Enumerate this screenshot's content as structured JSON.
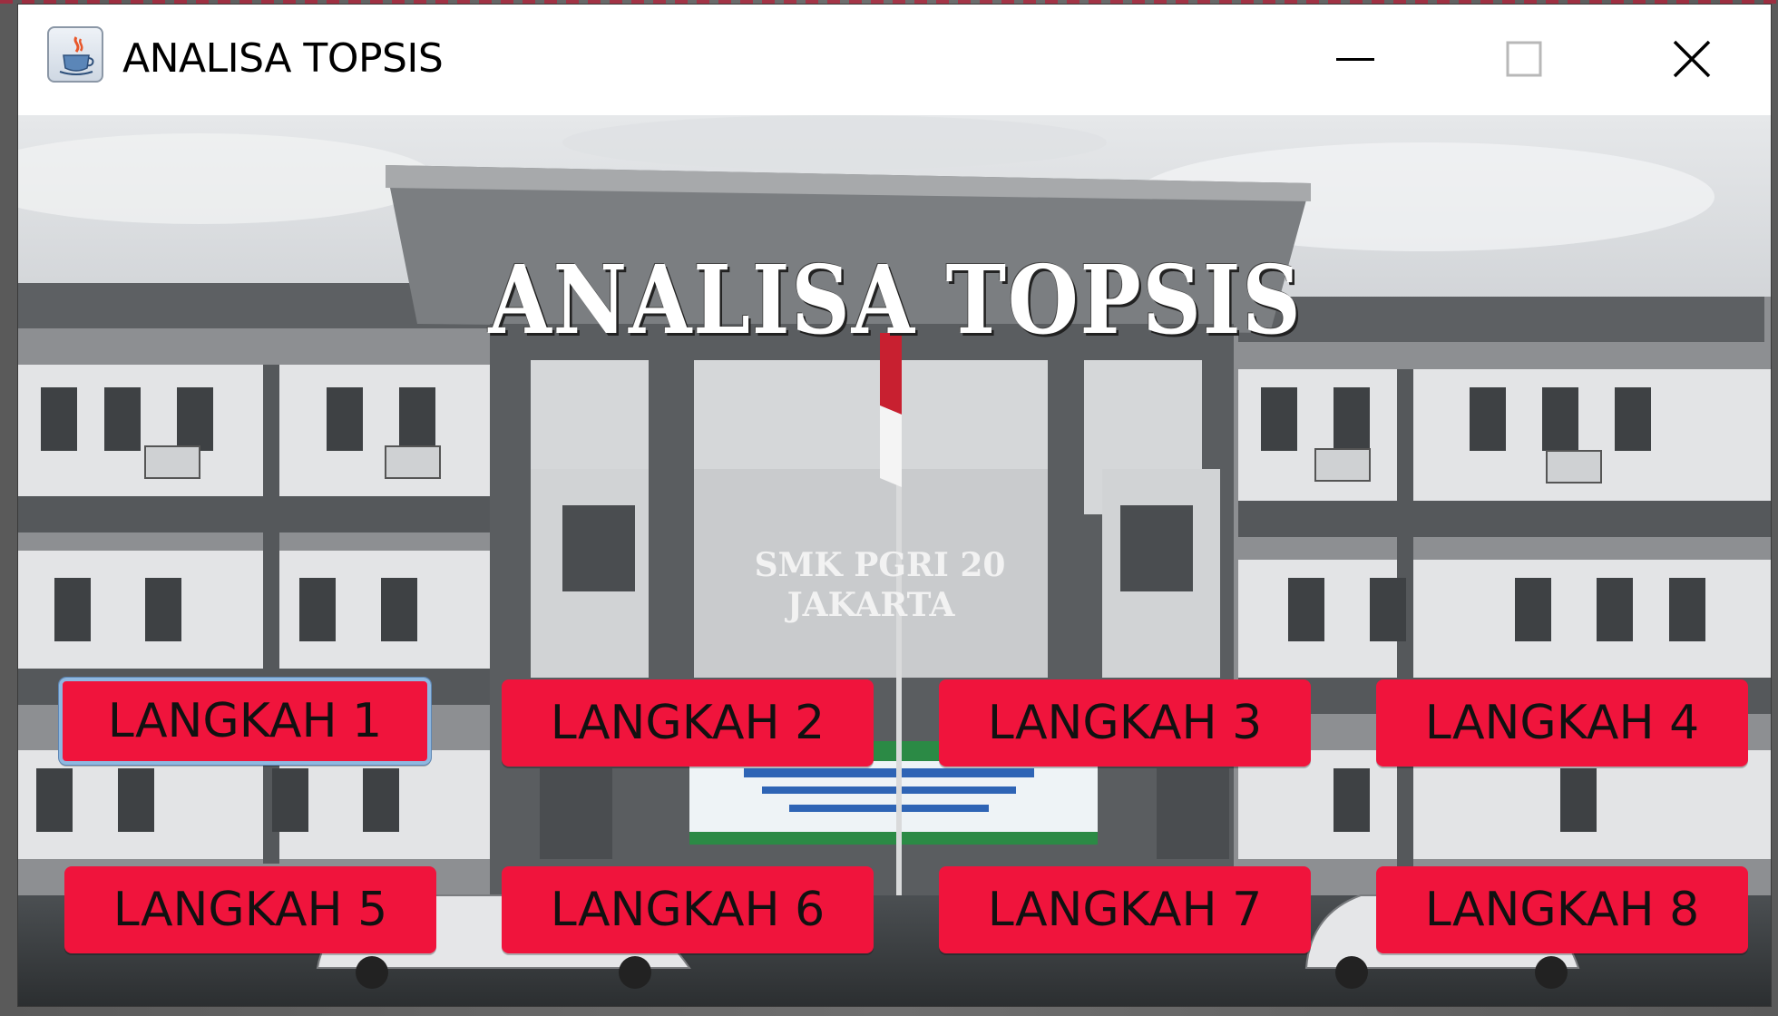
{
  "window": {
    "title": "ANALISA TOPSIS",
    "icon": "java-cup-icon",
    "controls": [
      "minimize-icon",
      "maximize-icon",
      "close-icon"
    ]
  },
  "main": {
    "heading": "ANALISA TOPSIS",
    "building_sign_line1": "SMK PGRI 20",
    "building_sign_line2": "JAKARTA",
    "buttons": [
      {
        "label": "LANGKAH 1"
      },
      {
        "label": "LANGKAH 2"
      },
      {
        "label": "LANGKAH 3"
      },
      {
        "label": "LANGKAH 4"
      },
      {
        "label": "LANGKAH 5"
      },
      {
        "label": "LANGKAH 6"
      },
      {
        "label": "LANGKAH 7"
      },
      {
        "label": "LANGKAH 8"
      }
    ],
    "focused_button": "LANGKAH 1"
  },
  "colors": {
    "button_bg": "#f0143c",
    "button_text": "#111111",
    "focus_ring": "#8fb8e0",
    "heading_text": "#ffffff"
  }
}
